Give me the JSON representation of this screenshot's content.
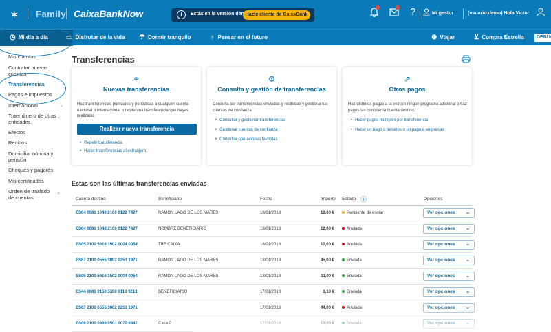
{
  "header": {
    "family": "Family",
    "brand": "CaixaBankNow",
    "demo_text": "Estás en la versión demo",
    "demo_cta": "Hazte cliente de CaixaBank",
    "gestor": "Mi gestor",
    "usuario": "(usuario demo) Hola Victor"
  },
  "nav": {
    "items": [
      {
        "label": "Mi día a día",
        "icon": "clock-icon"
      },
      {
        "label": "Disfrutar de la vida",
        "icon": "ticket-icon"
      },
      {
        "label": "Dormir tranquilo",
        "icon": "umbrella-icon"
      },
      {
        "label": "Pensar en el futuro",
        "icon": "piggy-bank-icon"
      },
      {
        "label": "Viajar",
        "icon": "globe-icon"
      },
      {
        "label": "Compra Estrella",
        "icon": "cart-icon"
      }
    ],
    "debug": "DEBUG"
  },
  "sidebar": {
    "items": [
      {
        "label": "Mis cuentas"
      },
      {
        "label": "Contratar nuevas cuentas"
      },
      {
        "label": "Transferencias"
      },
      {
        "label": "Pagos e impuestos"
      },
      {
        "label": "Internacional"
      },
      {
        "label": "Traer dinero de otras entidades"
      },
      {
        "label": "Efectos"
      },
      {
        "label": "Recibos"
      },
      {
        "label": "Domiciliar nómina y pensión"
      },
      {
        "label": "Cheques y pagarés"
      },
      {
        "label": "Mis certificados"
      },
      {
        "label": "Orden de traslado de cuentas"
      }
    ]
  },
  "page": {
    "title": "Transferencias"
  },
  "cards": [
    {
      "title": "Nuevas transferencias",
      "desc": "Haz transferencias puntuales y periódicas a cualquier cuenta nacional o internacional o repite una transferencia que hayas realizado.",
      "button": "Realizar nueva transferencia",
      "links": [
        "Repetir transferencia",
        "Hacer transferencias al extranjero"
      ]
    },
    {
      "title": "Consulta y gestión de transferencias",
      "desc": "Consulta las transferencias enviadas y recibidas y gestiona tus cuentas de confianza.",
      "links": [
        "Consultar y gestionar transferencias",
        "Gestionar cuentas de confianza",
        "Consultar operaciones favoritas"
      ]
    },
    {
      "title": "Otros pagos",
      "desc": "Haz distintos pagos a la vez sin ningún programa adicional o haz pagos sin conocer la cuenta destino.",
      "links": [
        "Hacer pagos múltiples por transferencia",
        "Hacer un pago a terceros o un pago a empresas"
      ]
    }
  ],
  "table": {
    "title": "Estas son las últimas transferencias enviadas",
    "headers": {
      "cuenta": "Cuenta destino",
      "beneficiario": "Beneficiario",
      "fecha": "Fecha",
      "importe": "Importe",
      "estado": "Estado",
      "opciones": "Opciones"
    },
    "option_label": "Ver opciones",
    "rows": [
      {
        "cuenta": "ES04 0081 1048 2100 0122 7427",
        "beneficiario": "RAMON LAGO DE LOS MARES",
        "fecha": "18/01/2018",
        "importe": "12,00 €",
        "estado": "Pendiente de enviar",
        "color": "#f5a623"
      },
      {
        "cuenta": "ES04 0081 1048 2100 0122 7427",
        "beneficiario": "NOMBRE BENEFICIARIO",
        "fecha": "18/01/2018",
        "importe": "12,00 €",
        "estado": "Anulada",
        "color": "#d0021b"
      },
      {
        "cuenta": "ES05 2100 5616 1502 0004 0054",
        "beneficiario": "TRF CAIXA",
        "fecha": "18/01/2018",
        "importe": "12,00 €",
        "estado": "Anulada",
        "color": "#d0021b"
      },
      {
        "cuenta": "ES67 2100 0555 3002 0251 1971",
        "beneficiario": "RAMON LAGO DE LOS MARES",
        "fecha": "18/01/2018",
        "importe": "45,00 €",
        "estado": "Enviada",
        "color": "#2e9e3e"
      },
      {
        "cuenta": "ES05 2100 5616 1502 0004 0054",
        "beneficiario": "RAMON LAGO DE LOS MARES",
        "fecha": "18/01/2018",
        "importe": "11,00 €",
        "estado": "Enviada",
        "color": "#2e9e3e"
      },
      {
        "cuenta": "ES44 0081 0150 5300 0110 9213",
        "beneficiario": "BENEFICIARIO",
        "fecha": "17/01/2018",
        "importe": "6,10 €",
        "estado": "Enviada",
        "color": "#2e9e3e"
      },
      {
        "cuenta": "ES67 2100 0555 3002 0251 1971",
        "beneficiario": "",
        "fecha": "17/01/2018",
        "importe": "44,00 €",
        "estado": "Anulada",
        "color": "#d0021b"
      },
      {
        "cuenta": "ES06 2100 0669 0501 0070 6842",
        "beneficiario": "Casa 2",
        "fecha": "17/01/2018",
        "importe": "12,00 €",
        "estado": "Enviada",
        "color": "#2e9e3e"
      }
    ]
  },
  "colors": {
    "brand_blue": "#0a7bb8",
    "dark_blue": "#0b3a63",
    "cta_yellow": "#f7b500"
  }
}
